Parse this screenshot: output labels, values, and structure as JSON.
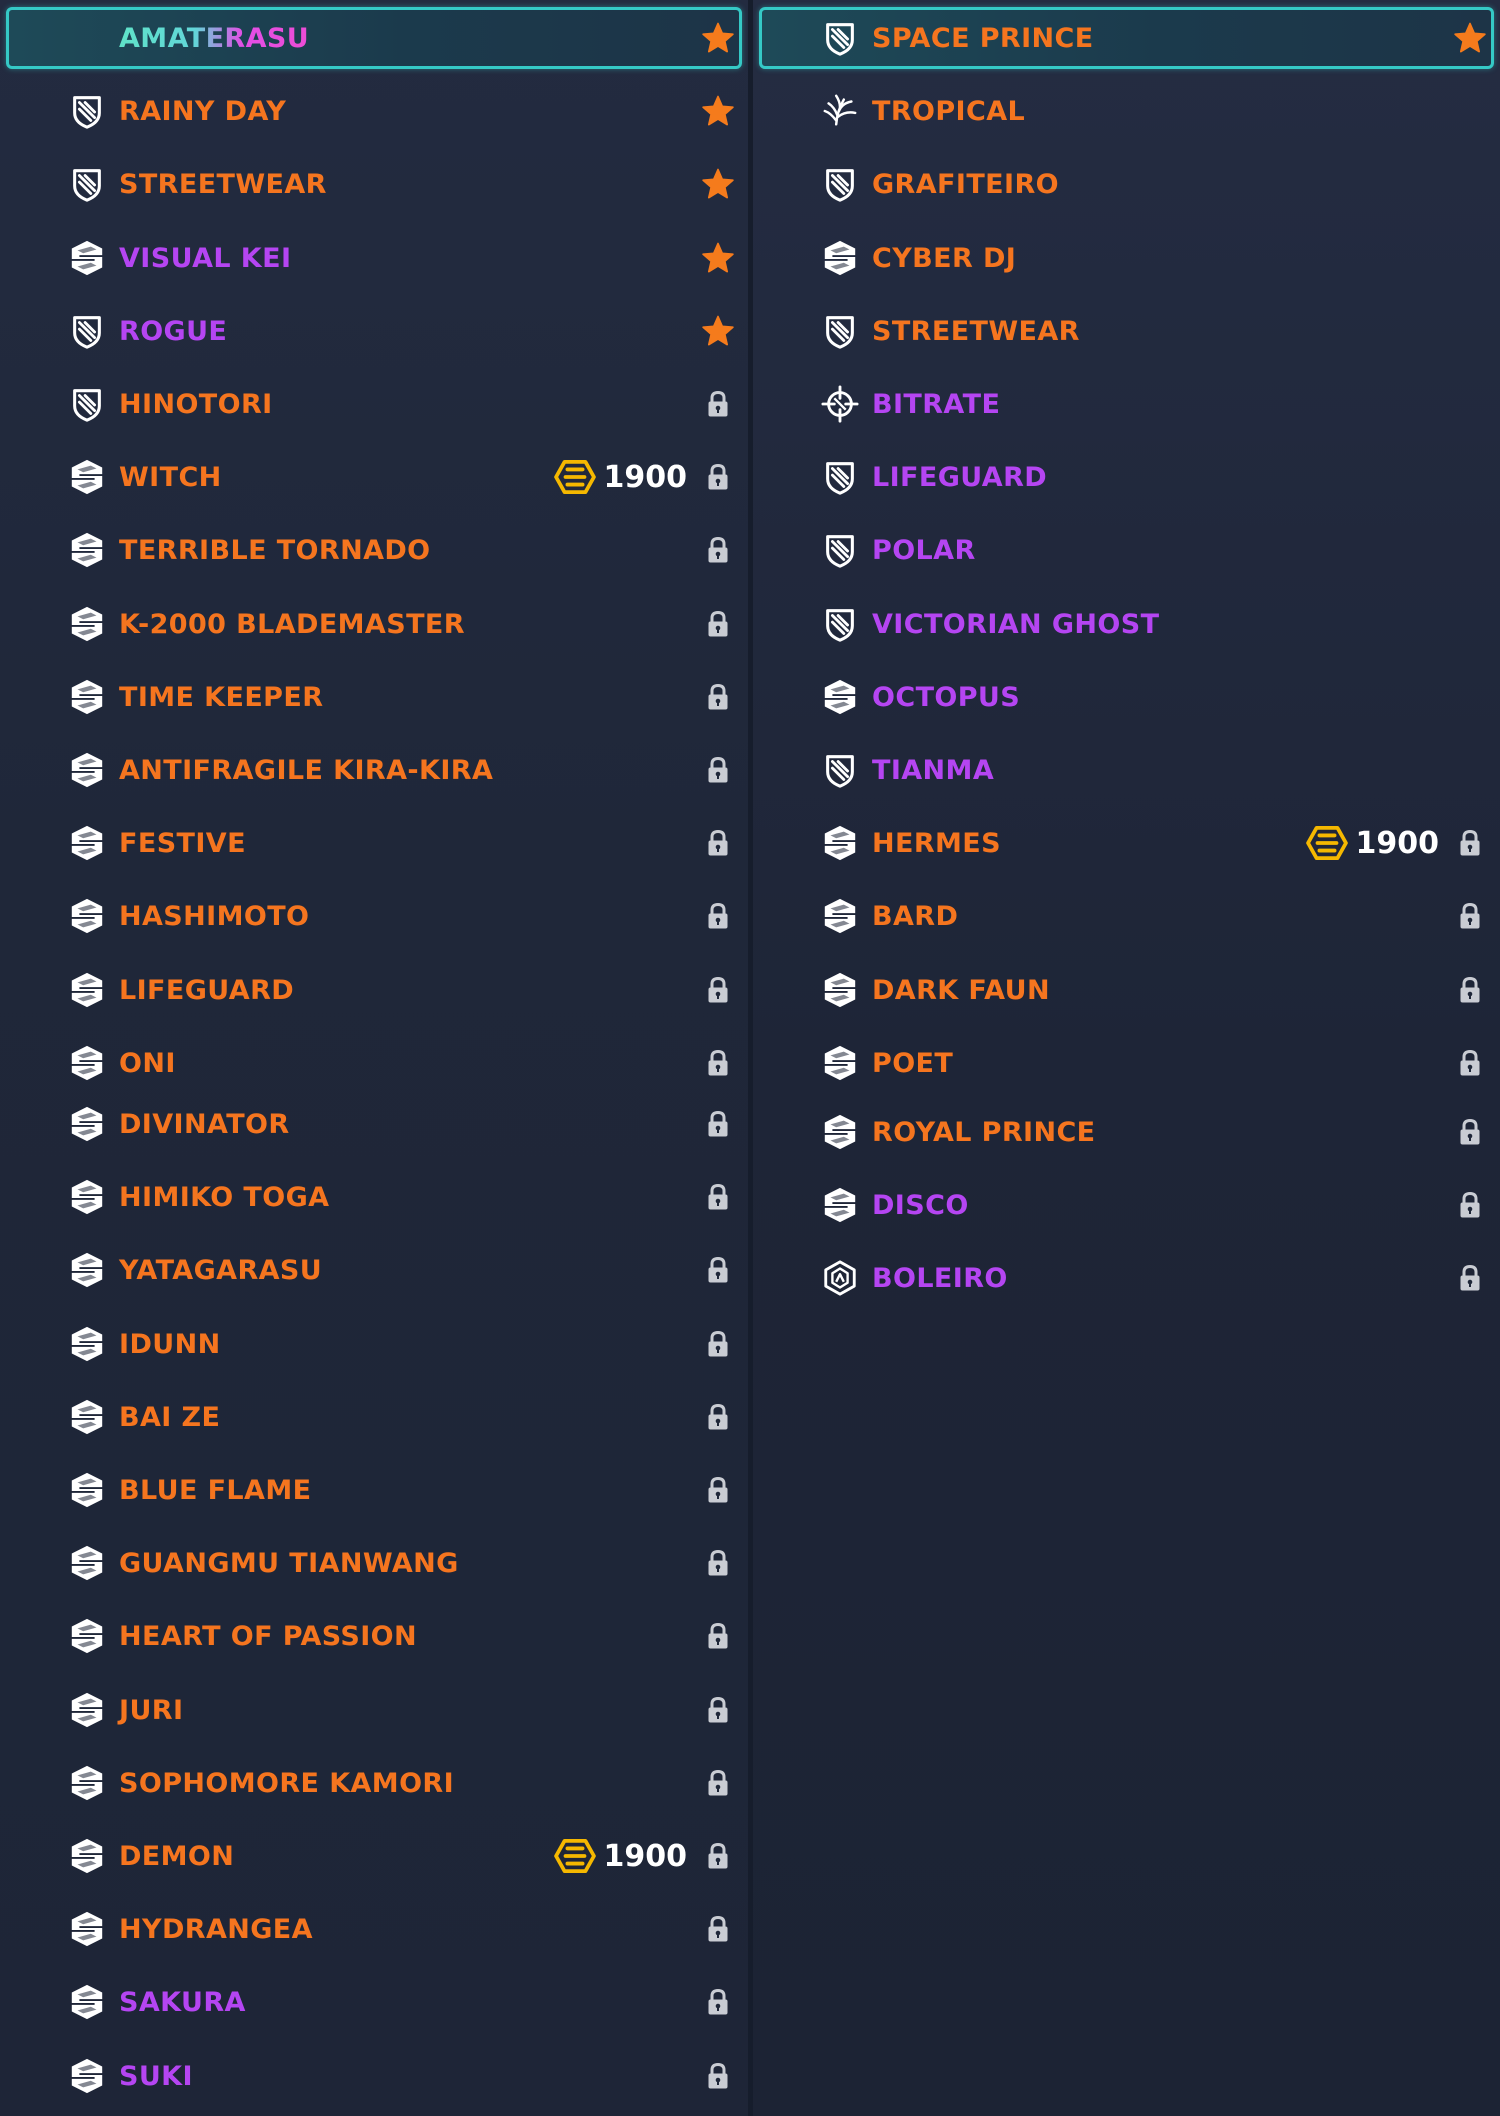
{
  "colors": {
    "orange": "#f5751f",
    "purple": "#b545f2",
    "selected_border": "#35c9c6",
    "coin": "#f5b800",
    "star": "#f57b1c",
    "lock": "#c9ccd3"
  },
  "left_column": {
    "items": [
      {
        "label": "AMATERASU",
        "color": "special",
        "icon": "none",
        "status": "star",
        "selected": true
      },
      {
        "label": "RAINY DAY",
        "color": "orange",
        "icon": "shield-stripes-icon",
        "status": "star"
      },
      {
        "label": "STREETWEAR",
        "color": "orange",
        "icon": "shield-stripes-icon",
        "status": "star"
      },
      {
        "label": "VISUAL KEI",
        "color": "purple",
        "icon": "skin-s-icon",
        "status": "star"
      },
      {
        "label": "ROGUE",
        "color": "purple",
        "icon": "shield-stripes-icon",
        "status": "star"
      },
      {
        "label": "HINOTORI",
        "color": "orange",
        "icon": "shield-stripes-icon",
        "status": "lock"
      },
      {
        "label": "WITCH",
        "color": "orange",
        "icon": "skin-s-icon",
        "status": "lock",
        "price": "1900"
      },
      {
        "label": "TERRIBLE TORNADO",
        "color": "orange",
        "icon": "skin-s-icon",
        "status": "lock"
      },
      {
        "label": "K-2000 BLADEMASTER",
        "color": "orange",
        "icon": "skin-s-icon",
        "status": "lock"
      },
      {
        "label": "TIME KEEPER",
        "color": "orange",
        "icon": "skin-s-icon",
        "status": "lock"
      },
      {
        "label": "ANTIFRAGILE KIRA-KIRA",
        "color": "orange",
        "icon": "skin-s-icon",
        "status": "lock"
      },
      {
        "label": "FESTIVE",
        "color": "orange",
        "icon": "skin-s-icon",
        "status": "lock"
      },
      {
        "label": "HASHIMOTO",
        "color": "orange",
        "icon": "skin-s-icon",
        "status": "lock"
      },
      {
        "label": "LIFEGUARD",
        "color": "orange",
        "icon": "skin-s-icon",
        "status": "lock"
      },
      {
        "label": "ONI",
        "color": "orange",
        "icon": "skin-s-icon",
        "status": "lock"
      },
      {
        "label": "DIVINATOR",
        "color": "orange",
        "icon": "skin-s-icon",
        "status": "lock"
      },
      {
        "label": "HIMIKO TOGA",
        "color": "orange",
        "icon": "skin-s-icon",
        "status": "lock"
      },
      {
        "label": "YATAGARASU",
        "color": "orange",
        "icon": "skin-s-icon",
        "status": "lock"
      },
      {
        "label": "IDUNN",
        "color": "orange",
        "icon": "skin-s-icon",
        "status": "lock"
      },
      {
        "label": "BAI ZE",
        "color": "orange",
        "icon": "skin-s-icon",
        "status": "lock"
      },
      {
        "label": "BLUE FLAME",
        "color": "orange",
        "icon": "skin-s-icon",
        "status": "lock"
      },
      {
        "label": "GUANGMU TIANWANG",
        "color": "orange",
        "icon": "skin-s-icon",
        "status": "lock"
      },
      {
        "label": "HEART OF PASSION",
        "color": "orange",
        "icon": "skin-s-icon",
        "status": "lock"
      },
      {
        "label": "JURI",
        "color": "orange",
        "icon": "skin-s-icon",
        "status": "lock"
      },
      {
        "label": "SOPHOMORE KAMORI",
        "color": "orange",
        "icon": "skin-s-icon",
        "status": "lock"
      },
      {
        "label": "DEMON",
        "color": "orange",
        "icon": "skin-s-icon",
        "status": "lock",
        "price": "1900"
      },
      {
        "label": "HYDRANGEA",
        "color": "orange",
        "icon": "skin-s-icon",
        "status": "lock"
      },
      {
        "label": "SAKURA",
        "color": "purple",
        "icon": "skin-s-icon",
        "status": "lock"
      },
      {
        "label": "SUKI",
        "color": "purple",
        "icon": "skin-s-icon",
        "status": "lock"
      }
    ]
  },
  "right_column": {
    "items": [
      {
        "label": "SPACE PRINCE",
        "color": "orange",
        "icon": "shield-stripes-icon",
        "status": "star",
        "selected": true
      },
      {
        "label": "TROPICAL",
        "color": "orange",
        "icon": "palm-leaf-icon",
        "status": "none"
      },
      {
        "label": "GRAFITEIRO",
        "color": "orange",
        "icon": "shield-stripes-icon",
        "status": "none"
      },
      {
        "label": "CYBER DJ",
        "color": "orange",
        "icon": "skin-s-icon",
        "status": "none"
      },
      {
        "label": "STREETWEAR",
        "color": "orange",
        "icon": "shield-stripes-icon",
        "status": "none"
      },
      {
        "label": "BITRATE",
        "color": "purple",
        "icon": "crosshair-icon",
        "status": "none"
      },
      {
        "label": "LIFEGUARD",
        "color": "purple",
        "icon": "shield-stripes-icon",
        "status": "none"
      },
      {
        "label": "POLAR",
        "color": "purple",
        "icon": "shield-stripes-icon",
        "status": "none"
      },
      {
        "label": "VICTORIAN GHOST",
        "color": "purple",
        "icon": "shield-stripes-icon",
        "status": "none"
      },
      {
        "label": "OCTOPUS",
        "color": "purple",
        "icon": "skin-s-icon",
        "status": "none"
      },
      {
        "label": "TIANMA",
        "color": "purple",
        "icon": "shield-stripes-icon",
        "status": "none"
      },
      {
        "label": "HERMES",
        "color": "orange",
        "icon": "skin-s-icon",
        "status": "lock",
        "price": "1900"
      },
      {
        "label": "BARD",
        "color": "orange",
        "icon": "skin-s-icon",
        "status": "lock"
      },
      {
        "label": "DARK FAUN",
        "color": "orange",
        "icon": "skin-s-icon",
        "status": "lock"
      },
      {
        "label": "POET",
        "color": "orange",
        "icon": "skin-s-icon",
        "status": "lock"
      },
      {
        "label": "ROYAL PRINCE",
        "color": "orange",
        "icon": "skin-s-icon",
        "status": "lock"
      },
      {
        "label": "DISCO",
        "color": "purple",
        "icon": "skin-s-icon",
        "status": "lock"
      },
      {
        "label": "BOLEIRO",
        "color": "purple",
        "icon": "hexagon-badge-icon",
        "status": "lock"
      }
    ]
  }
}
